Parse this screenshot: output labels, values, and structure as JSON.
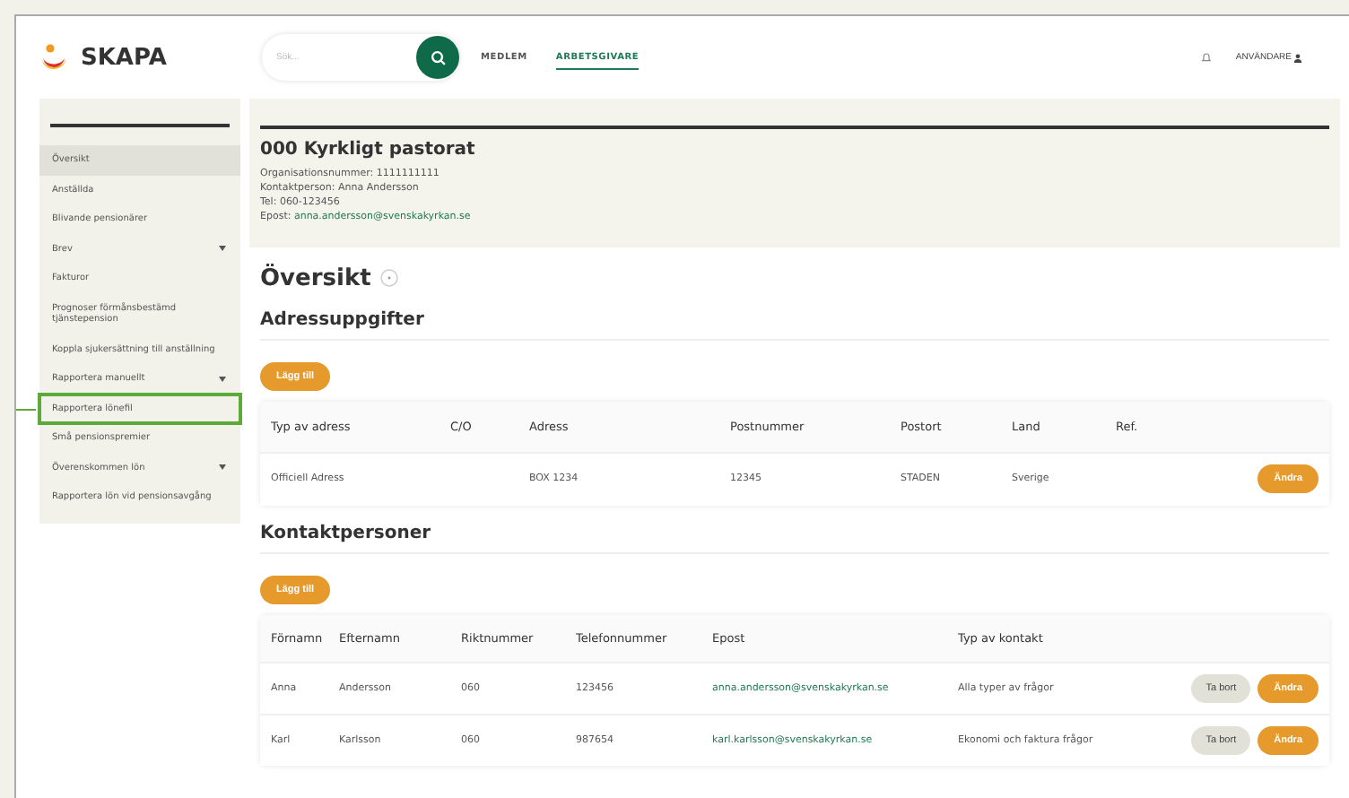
{
  "header": {
    "logo": "SKAPA",
    "search": {
      "placeholder": "Sök..."
    },
    "nav": [
      {
        "label": "MEDLEM",
        "selected": false
      },
      {
        "label": "ARBETSGIVARE",
        "selected": true
      }
    ],
    "user": "ANVÄNDARE"
  },
  "sidebar": {
    "items": [
      {
        "label": "Översikt",
        "selected": true,
        "expandable": false,
        "highlighted": false
      },
      {
        "label": "Anställda",
        "selected": false,
        "expandable": false,
        "highlighted": false
      },
      {
        "label": "Blivande pensionärer",
        "selected": false,
        "expandable": false,
        "highlighted": false
      },
      {
        "label": "Brev",
        "selected": false,
        "expandable": true,
        "highlighted": false
      },
      {
        "label": "Fakturor",
        "selected": false,
        "expandable": false,
        "highlighted": false
      },
      {
        "label": "Prognoser förmånsbestämd tjänstepension",
        "selected": false,
        "expandable": false,
        "highlighted": false
      },
      {
        "label": "Koppla sjukersättning till anställning",
        "selected": false,
        "expandable": false,
        "highlighted": false
      },
      {
        "label": "Rapportera manuellt",
        "selected": false,
        "expandable": true,
        "highlighted": false
      },
      {
        "label": "Rapportera lönefil",
        "selected": false,
        "expandable": false,
        "highlighted": true
      },
      {
        "label": "Små pensionspremier",
        "selected": false,
        "expandable": false,
        "highlighted": false
      },
      {
        "label": "Överenskommen lön",
        "selected": false,
        "expandable": true,
        "highlighted": false
      },
      {
        "label": "Rapportera lön vid pensionsavgång",
        "selected": false,
        "expandable": false,
        "highlighted": false
      }
    ]
  },
  "organization": {
    "title": "000 Kyrkligt pastorat",
    "lines": [
      "Organisationsnummer: 1111111111",
      "Kontaktperson: Anna Andersson",
      "Tel: 060-123456"
    ],
    "email_label": "Epost:",
    "email": "anna.andersson@svenskakyrkan.se"
  },
  "page_title": "Översikt",
  "address_section": {
    "title": "Adressuppgifter",
    "add_button": "Lägg till",
    "columns": [
      "Typ av adress",
      "C/O",
      "Adress",
      "Postnummer",
      "Postort",
      "Land",
      "Ref."
    ],
    "rows": [
      {
        "cells": [
          "Officiell Adress",
          "",
          "BOX 1234",
          "12345",
          "STADEN",
          "Sverige",
          ""
        ],
        "edit": "Ändra"
      }
    ]
  },
  "contact_section": {
    "title": "Kontaktpersoner",
    "add_button": "Lägg till",
    "columns": [
      "Förnamn",
      "Efternamn",
      "Riktnummer",
      "Telefonnummer",
      "Epost",
      "Typ av kontakt"
    ],
    "rows": [
      {
        "cells": [
          "Anna",
          "Andersson",
          "060",
          "123456",
          "anna.andersson@svenskakyrkan.se",
          "Alla typer av frågor"
        ],
        "remove": "Ta bort",
        "edit": "Ändra"
      },
      {
        "cells": [
          "Karl",
          "Karlsson",
          "060",
          "987654",
          "karl.karlsson@svenskakyrkan.se",
          "Ekonomi och faktura frågor"
        ],
        "remove": "Ta bort",
        "edit": "Ändra"
      }
    ]
  }
}
